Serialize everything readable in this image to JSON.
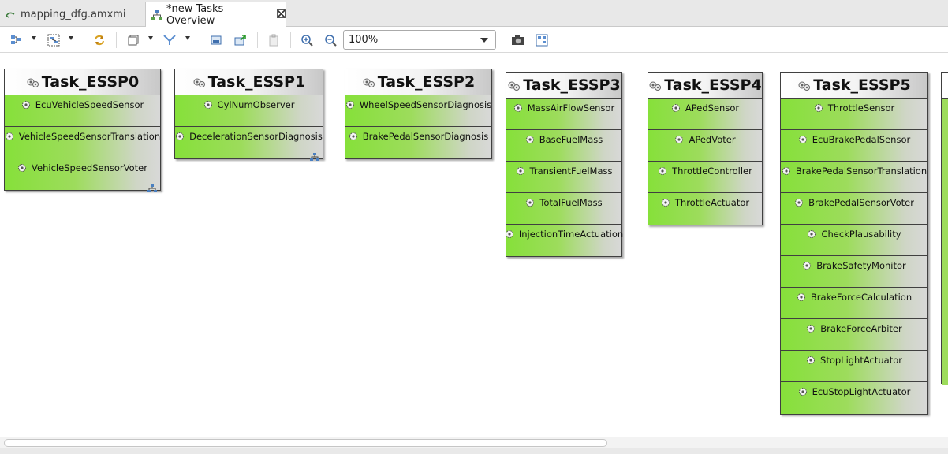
{
  "tabs": [
    {
      "label": "mapping_dfg.amxmi",
      "active": false,
      "icon": "model-file-icon"
    },
    {
      "label": "*new Tasks Overview",
      "active": true,
      "icon": "diagram-icon",
      "close_icon": "close-icon"
    }
  ],
  "toolbar": {
    "zoom_value": "100%",
    "icons": [
      "arrange-all-icon",
      "select-all-icon",
      "refresh-icon",
      "layer-icon",
      "filter-icon",
      "export-image-icon",
      "export-icon",
      "paste-icon",
      "zoom-in-icon",
      "zoom-out-icon",
      "camera-icon",
      "fit-diagram-icon"
    ]
  },
  "tasks": [
    {
      "title": "Task_ESSP0",
      "runnables": [
        "EcuVehicleSpeedSensor",
        "VehicleSpeedSensorTranslation",
        "VehicleSpeedSensorVoter"
      ]
    },
    {
      "title": "Task_ESSP1",
      "runnables": [
        "CylNumObserver",
        "DecelerationSensorDiagnosis"
      ]
    },
    {
      "title": "Task_ESSP2",
      "runnables": [
        "WheelSpeedSensorDiagnosis",
        "BrakePedalSensorDiagnosis"
      ]
    },
    {
      "title": "Task_ESSP3",
      "runnables": [
        "MassAirFlowSensor",
        "BaseFuelMass",
        "TransientFuelMass",
        "TotalFuelMass",
        "InjectionTimeActuation"
      ]
    },
    {
      "title": "Task_ESSP4",
      "runnables": [
        "APedSensor",
        "APedVoter",
        "ThrottleController",
        "ThrottleActuator"
      ]
    },
    {
      "title": "Task_ESSP5",
      "runnables": [
        "ThrottleSensor",
        "EcuBrakePedalSensor",
        "BrakePedalSensorTranslation",
        "BrakePedalSensorVoter",
        "CheckPlausability",
        "BrakeSafetyMonitor",
        "BrakeForceCalculation",
        "BrakeForceArbiter",
        "StopLightActuator",
        "EcuStopLightActuator"
      ]
    }
  ],
  "colors": {
    "runnable_green": "#86e03a",
    "header_gray": "#c8c8c8",
    "border": "#404040"
  }
}
